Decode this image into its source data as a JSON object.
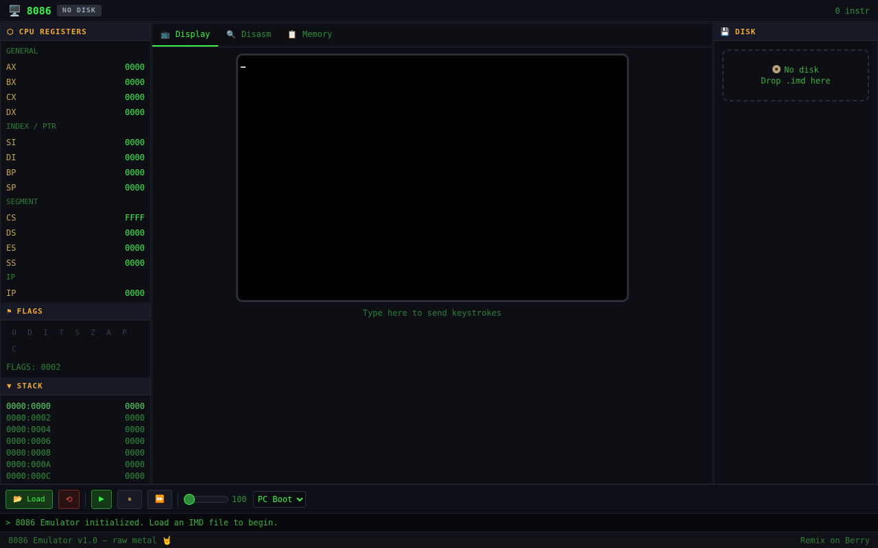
{
  "header": {
    "logo_icon": "computer-icon",
    "logo_glyph": "🖥️",
    "title": "8086",
    "disk_badge": "NO DISK",
    "instr_count": "0 instr"
  },
  "registers": {
    "title": "CPU REGISTERS",
    "icon_glyph": "⬡",
    "groups": [
      {
        "label": "GENERAL",
        "regs": [
          {
            "name": "AX",
            "value": "0000"
          },
          {
            "name": "BX",
            "value": "0000"
          },
          {
            "name": "CX",
            "value": "0000"
          },
          {
            "name": "DX",
            "value": "0000"
          }
        ]
      },
      {
        "label": "INDEX / PTR",
        "regs": [
          {
            "name": "SI",
            "value": "0000"
          },
          {
            "name": "DI",
            "value": "0000"
          },
          {
            "name": "BP",
            "value": "0000"
          },
          {
            "name": "SP",
            "value": "0000"
          }
        ]
      },
      {
        "label": "SEGMENT",
        "regs": [
          {
            "name": "CS",
            "value": "FFFF"
          },
          {
            "name": "DS",
            "value": "0000"
          },
          {
            "name": "ES",
            "value": "0000"
          },
          {
            "name": "SS",
            "value": "0000"
          }
        ]
      },
      {
        "label": "IP",
        "regs": [
          {
            "name": "IP",
            "value": "0000"
          }
        ]
      }
    ]
  },
  "flags": {
    "title": "FLAGS",
    "icon_glyph": "⚑",
    "bits": [
      "O",
      "D",
      "I",
      "T",
      "S",
      "Z",
      "A",
      "P",
      "C"
    ],
    "value_text": "FLAGS: 0002"
  },
  "stack": {
    "title": "STACK",
    "icon_glyph": "▼",
    "rows": [
      {
        "addr": "0000:0000",
        "value": "0000"
      },
      {
        "addr": "0000:0002",
        "value": "0000"
      },
      {
        "addr": "0000:0004",
        "value": "0000"
      },
      {
        "addr": "0000:0006",
        "value": "0000"
      },
      {
        "addr": "0000:0008",
        "value": "0000"
      },
      {
        "addr": "0000:000A",
        "value": "0000"
      },
      {
        "addr": "0000:000C",
        "value": "0000"
      }
    ]
  },
  "tabs": [
    {
      "label": "Display",
      "icon": "monitor-icon",
      "glyph": "📺",
      "active": true
    },
    {
      "label": "Disasm",
      "icon": "magnifier-icon",
      "glyph": "🔍",
      "active": false
    },
    {
      "label": "Memory",
      "icon": "clipboard-icon",
      "glyph": "📋",
      "active": false
    }
  ],
  "display": {
    "hint": "Type here to send keystrokes"
  },
  "disk": {
    "title": "DISK",
    "icon_glyph": "💾",
    "status": "No disk",
    "drop_hint": "Drop .imd here"
  },
  "toolbar": {
    "load_icon_glyph": "📂",
    "load_label": "Load",
    "reset_glyph": "⟲",
    "run_glyph": "▶",
    "pause_glyph": "⏸",
    "step_glyph": "⏩",
    "speed_value": "100",
    "speed_level": 0,
    "boot_options": [
      "PC Boot"
    ],
    "boot_selected": "PC Boot"
  },
  "log": {
    "message": "> 8086 Emulator initialized. Load an IMD file to begin."
  },
  "status": {
    "version": "8086 Emulator v1.0 — raw metal 🤘",
    "remix": "Remix on Berry"
  },
  "colors": {
    "accent_green": "#3cf24a",
    "header_orange": "#f0a830",
    "register_name": "#c8a44a",
    "reset_red": "#e04848",
    "background": "#0b0d12"
  }
}
